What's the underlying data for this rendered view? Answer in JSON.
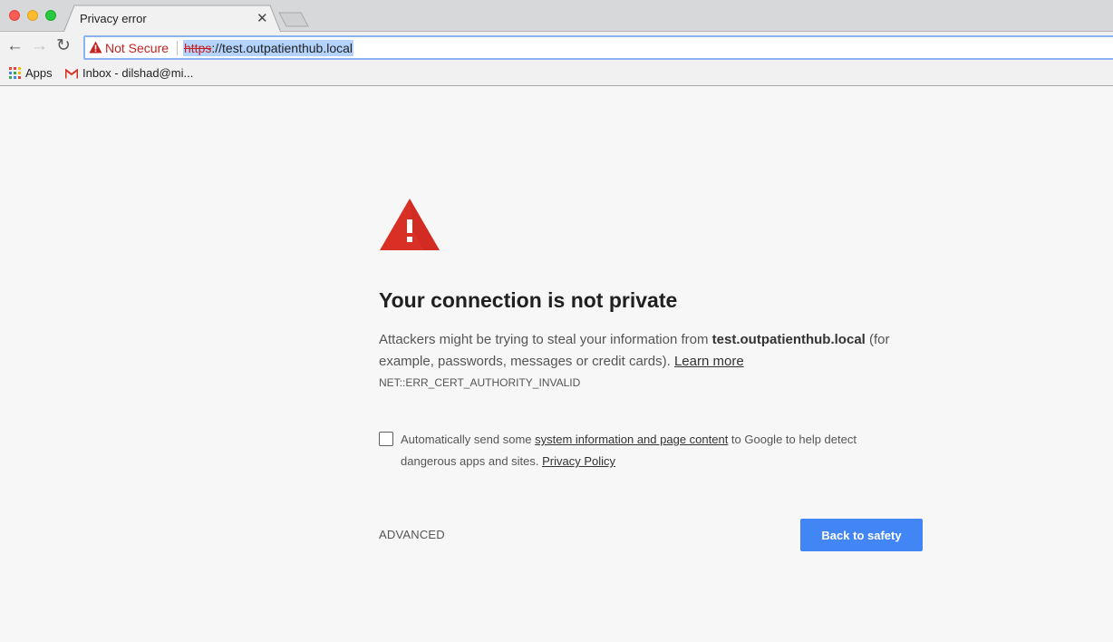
{
  "window": {
    "tab_title": "Privacy error",
    "tab_close_icon": "close-icon"
  },
  "toolbar": {
    "back_icon": "arrow-left-icon",
    "forward_icon": "arrow-right-icon",
    "reload_icon": "reload-icon",
    "security_label": "Not Secure",
    "security_icon": "warning-triangle-icon",
    "url_scheme": "https",
    "url_rest": "://test.outpatienthub.local"
  },
  "bookmarks": [
    {
      "label": "Apps",
      "icon": "apps-grid-icon"
    },
    {
      "label": "Inbox - dilshad@mi...",
      "icon": "gmail-icon"
    }
  ],
  "interstitial": {
    "icon": "warning-triangle-icon",
    "heading": "Your connection is not private",
    "desc_pre": "Attackers might be trying to steal your information from ",
    "desc_host": "test.outpatienthub.local",
    "desc_post": " (for example, passwords, messages or credit cards). ",
    "learn_more": "Learn more",
    "error_code": "NET::ERR_CERT_AUTHORITY_INVALID",
    "checkbox_checked": false,
    "cb_pre": "Automatically send some ",
    "cb_link": "system information and page content",
    "cb_mid": " to Google to help detect dangerous apps and sites. ",
    "cb_policy": "Privacy Policy",
    "advanced_label": "ADVANCED",
    "back_to_safety_label": "Back to safety"
  },
  "colors": {
    "accent_button": "#4285f4",
    "warning_red": "#d93025",
    "not_secure_red": "#c5221f"
  }
}
